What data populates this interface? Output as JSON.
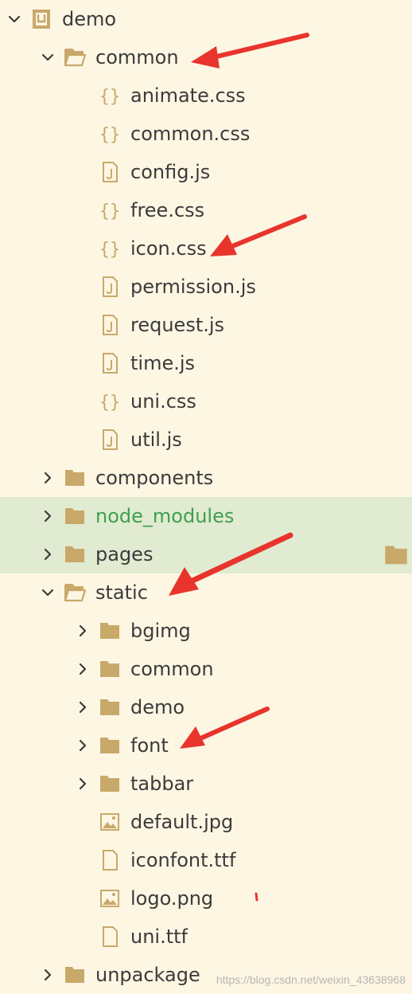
{
  "tree": [
    {
      "label": "demo",
      "icon": "project-icon",
      "chevron": "down",
      "level": 0
    },
    {
      "label": "common",
      "icon": "folder-open-icon",
      "chevron": "down",
      "level": 1
    },
    {
      "label": "animate.css",
      "icon": "css-file-icon",
      "chevron": "none",
      "level": 2
    },
    {
      "label": "common.css",
      "icon": "css-file-icon",
      "chevron": "none",
      "level": 2
    },
    {
      "label": "config.js",
      "icon": "js-file-icon",
      "chevron": "none",
      "level": 2
    },
    {
      "label": "free.css",
      "icon": "css-file-icon",
      "chevron": "none",
      "level": 2
    },
    {
      "label": "icon.css",
      "icon": "css-file-icon",
      "chevron": "none",
      "level": 2
    },
    {
      "label": "permission.js",
      "icon": "js-file-icon",
      "chevron": "none",
      "level": 2
    },
    {
      "label": "request.js",
      "icon": "js-file-icon",
      "chevron": "none",
      "level": 2
    },
    {
      "label": "time.js",
      "icon": "js-file-icon",
      "chevron": "none",
      "level": 2
    },
    {
      "label": "uni.css",
      "icon": "css-file-icon",
      "chevron": "none",
      "level": 2
    },
    {
      "label": "util.js",
      "icon": "js-file-icon",
      "chevron": "none",
      "level": 2
    },
    {
      "label": "components",
      "icon": "folder-icon",
      "chevron": "right",
      "level": 1
    },
    {
      "label": "node_modules",
      "icon": "folder-icon",
      "chevron": "right",
      "level": 1,
      "highlighted": true,
      "green": true
    },
    {
      "label": "pages",
      "icon": "folder-icon",
      "chevron": "right",
      "level": 1,
      "highlighted": true,
      "right_icon": "folder-icon"
    },
    {
      "label": "static",
      "icon": "folder-open-icon",
      "chevron": "down",
      "level": 1
    },
    {
      "label": "bgimg",
      "icon": "folder-icon",
      "chevron": "right",
      "level": 2
    },
    {
      "label": "common",
      "icon": "folder-icon",
      "chevron": "right",
      "level": 2
    },
    {
      "label": "demo",
      "icon": "folder-icon",
      "chevron": "right",
      "level": 2
    },
    {
      "label": "font",
      "icon": "folder-icon",
      "chevron": "right",
      "level": 2
    },
    {
      "label": "tabbar",
      "icon": "folder-icon",
      "chevron": "right",
      "level": 2
    },
    {
      "label": "default.jpg",
      "icon": "image-file-icon",
      "chevron": "none",
      "level": 2
    },
    {
      "label": "iconfont.ttf",
      "icon": "file-icon",
      "chevron": "none",
      "level": 2
    },
    {
      "label": "logo.png",
      "icon": "image-file-icon",
      "chevron": "none",
      "level": 2
    },
    {
      "label": "uni.ttf",
      "icon": "file-icon",
      "chevron": "none",
      "level": 2
    },
    {
      "label": "unpackage",
      "icon": "folder-icon",
      "chevron": "right",
      "level": 1
    }
  ],
  "watermark": "https://blog.csdn.net/weixin_43638968",
  "colors": {
    "background": "#fdf6e3",
    "highlight": "#e0ebd1",
    "folder": "#c8a96a",
    "text": "#3b3b3b",
    "green_text": "#3f9f4e",
    "arrow": "#e8342c"
  }
}
